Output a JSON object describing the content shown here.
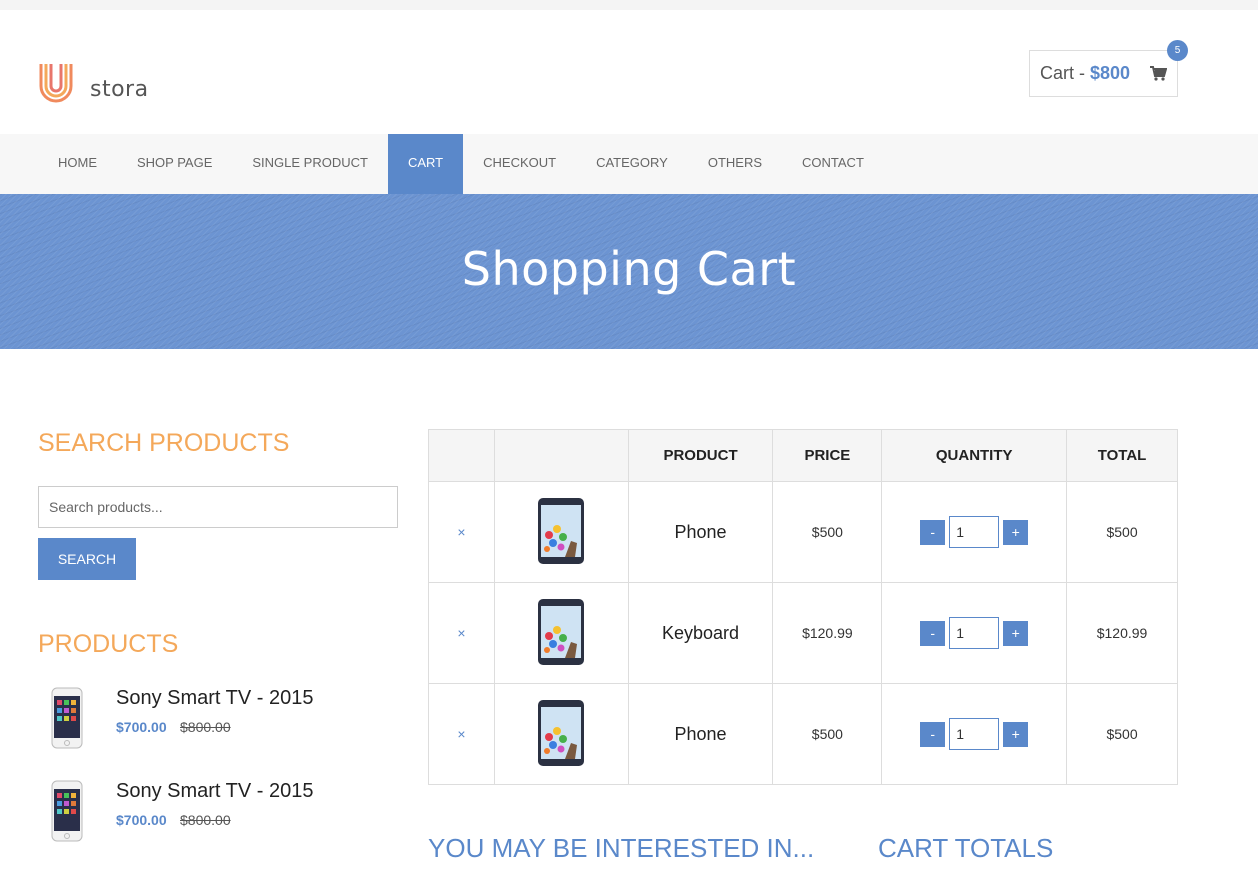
{
  "header": {
    "logo_text": "stora",
    "cart_label": "Cart -",
    "cart_amount": "$800",
    "cart_count": "5",
    "cart_icon": "shopping-cart-icon"
  },
  "nav": {
    "items": [
      {
        "label": "HOME"
      },
      {
        "label": "SHOP PAGE"
      },
      {
        "label": "SINGLE PRODUCT"
      },
      {
        "label": "CART"
      },
      {
        "label": "CHECKOUT"
      },
      {
        "label": "CATEGORY"
      },
      {
        "label": "OTHERS"
      },
      {
        "label": "CONTACT"
      }
    ],
    "active": "CART"
  },
  "banner": {
    "title": "Shopping Cart"
  },
  "sidebar": {
    "search_title": "SEARCH PRODUCTS",
    "search_placeholder": "Search products...",
    "search_button": "SEARCH",
    "products_title": "PRODUCTS",
    "products": [
      {
        "name": "Sony Smart TV - 2015",
        "price": "$700.00",
        "old_price": "$800.00"
      },
      {
        "name": "Sony Smart TV - 2015",
        "price": "$700.00",
        "old_price": "$800.00"
      }
    ]
  },
  "cart_table": {
    "headers": [
      "",
      "",
      "PRODUCT",
      "PRICE",
      "QUANTITY",
      "TOTAL"
    ],
    "remove_symbol": "×",
    "minus": "-",
    "plus": "+",
    "rows": [
      {
        "product": "Phone",
        "price": "$500",
        "quantity": "1",
        "total": "$500"
      },
      {
        "product": "Keyboard",
        "price": "$120.99",
        "quantity": "1",
        "total": "$120.99"
      },
      {
        "product": "Phone",
        "price": "$500",
        "quantity": "1",
        "total": "$500"
      }
    ]
  },
  "sections": {
    "interested": "YOU MAY BE INTERESTED IN...",
    "cart_totals": "CART TOTALS"
  },
  "colors": {
    "accent": "#5a88ca",
    "orange": "#f4a85a"
  }
}
